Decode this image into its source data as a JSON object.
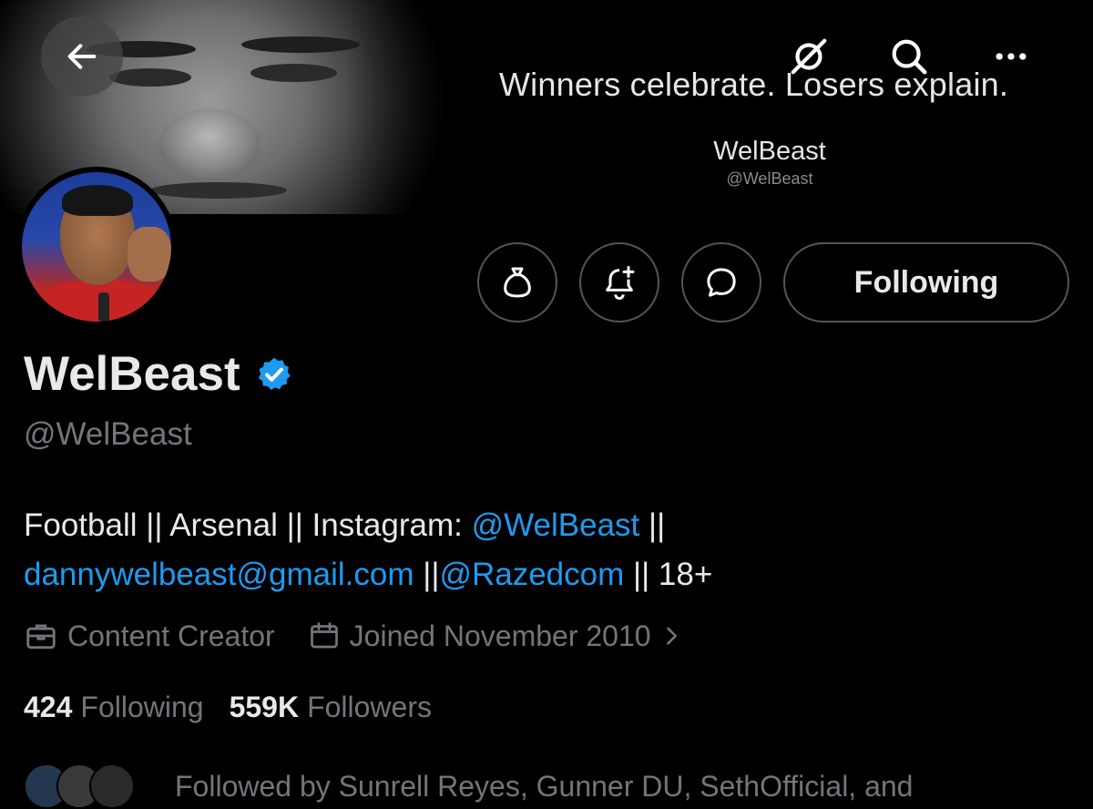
{
  "banner": {
    "motto": "Winners celebrate. Losers explain.",
    "name": "WelBeast",
    "handle": "@WelBeast"
  },
  "nav": {
    "back_icon": "arrow-left-icon",
    "grok_icon": "grok-icon",
    "search_icon": "search-icon",
    "more_icon": "more-icon"
  },
  "actions": {
    "tip_icon": "money-bag-icon",
    "notify_icon": "bell-plus-icon",
    "message_icon": "message-icon",
    "following_label": "Following"
  },
  "profile": {
    "display_name": "WelBeast",
    "handle": "@WelBeast",
    "bio": {
      "p1": "Football || Arsenal || Instagram: ",
      "link1": "@WelBeast",
      "p2": " ||",
      "link2": "dannywelbeast@gmail.com",
      "p3": " ||",
      "link3": "@Razedcom",
      "p4": " || 18+"
    },
    "category": "Content Creator",
    "joined": "Joined November 2010",
    "following_count": "424",
    "following_label": "Following",
    "followers_count": "559K",
    "followers_label": "Followers",
    "followed_by": "Followed by Sunrell Reyes, Gunner DU, SethOfficial, and"
  },
  "colors": {
    "accent": "#1d9bf0",
    "secondary_text": "#71767b",
    "primary_text": "#e7e9ea",
    "background": "#000000"
  }
}
